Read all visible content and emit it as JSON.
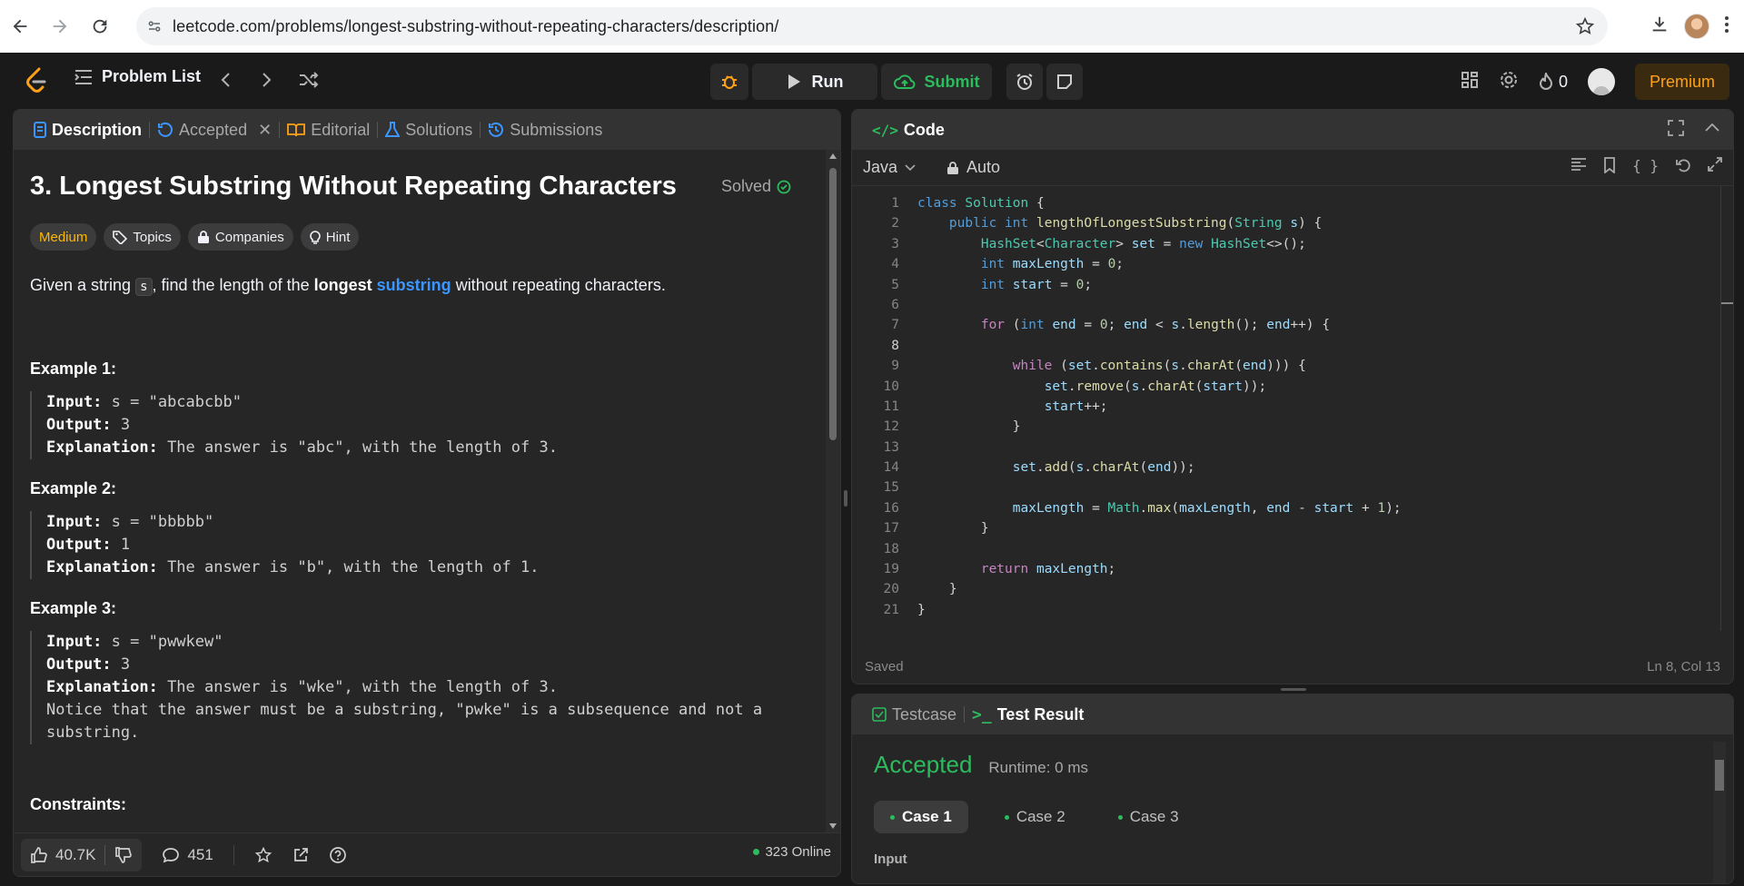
{
  "browser": {
    "url": "leetcode.com/problems/longest-substring-without-repeating-characters/description/"
  },
  "nav": {
    "problem_list": "Problem List",
    "run": "Run",
    "submit": "Submit",
    "streak": "0",
    "premium": "Premium"
  },
  "tabs": {
    "description": "Description",
    "accepted": "Accepted",
    "editorial": "Editorial",
    "solutions": "Solutions",
    "submissions": "Submissions"
  },
  "problem": {
    "title": "3. Longest Substring Without Repeating Characters",
    "solved": "Solved",
    "difficulty": "Medium",
    "topics": "Topics",
    "companies": "Companies",
    "hint": "Hint",
    "statement_pre": "Given a string ",
    "statement_var": "s",
    "statement_mid": ", find the length of the ",
    "statement_bold": "longest",
    "statement_link": "substring",
    "statement_post": " without repeating characters.",
    "examples": [
      {
        "title": "Example 1:",
        "input": " s = \"abcabcbb\"",
        "output": " 3",
        "explanation": " The answer is \"abc\", with the length of 3.",
        "note": ""
      },
      {
        "title": "Example 2:",
        "input": " s = \"bbbbb\"",
        "output": " 1",
        "explanation": " The answer is \"b\", with the length of 1.",
        "note": ""
      },
      {
        "title": "Example 3:",
        "input": " s = \"pwwkew\"",
        "output": " 3",
        "explanation": " The answer is \"wke\", with the length of 3.",
        "note": "Notice that the answer must be a substring, \"pwke\" is a subsequence and not a\nsubstring."
      }
    ],
    "labels": {
      "input": "Input:",
      "output": "Output:",
      "explanation": "Explanation:"
    },
    "partial_heading": "Constraints:"
  },
  "footer": {
    "likes": "40.7K",
    "comments": "451",
    "online": "323 Online"
  },
  "code_panel": {
    "title": "Code",
    "language": "Java",
    "mode": "Auto",
    "status_saved": "Saved",
    "cursor": "Ln 8, Col 13",
    "current_line": 8,
    "lines": [
      "class Solution {",
      "    public int lengthOfLongestSubstring(String s) {",
      "        HashSet<Character> set = new HashSet<>();",
      "        int maxLength = 0;",
      "        int start = 0;",
      "",
      "        for (int end = 0; end < s.length(); end++) {",
      "",
      "            while (set.contains(s.charAt(end))) {",
      "                set.remove(s.charAt(start));",
      "                start++;",
      "            }",
      "",
      "            set.add(s.charAt(end));",
      "",
      "            maxLength = Math.max(maxLength, end - start + 1);",
      "        }",
      "",
      "        return maxLength;",
      "    }",
      "}"
    ]
  },
  "result_panel": {
    "testcase_tab": "Testcase",
    "result_tab": "Test Result",
    "status": "Accepted",
    "runtime": "Runtime: 0 ms",
    "cases": [
      "Case 1",
      "Case 2",
      "Case 3"
    ],
    "input_label": "Input"
  },
  "colors": {
    "accent": "#ffa116",
    "success": "#2cbb5d",
    "medium": "#ffb800",
    "link": "#3b96ff"
  }
}
